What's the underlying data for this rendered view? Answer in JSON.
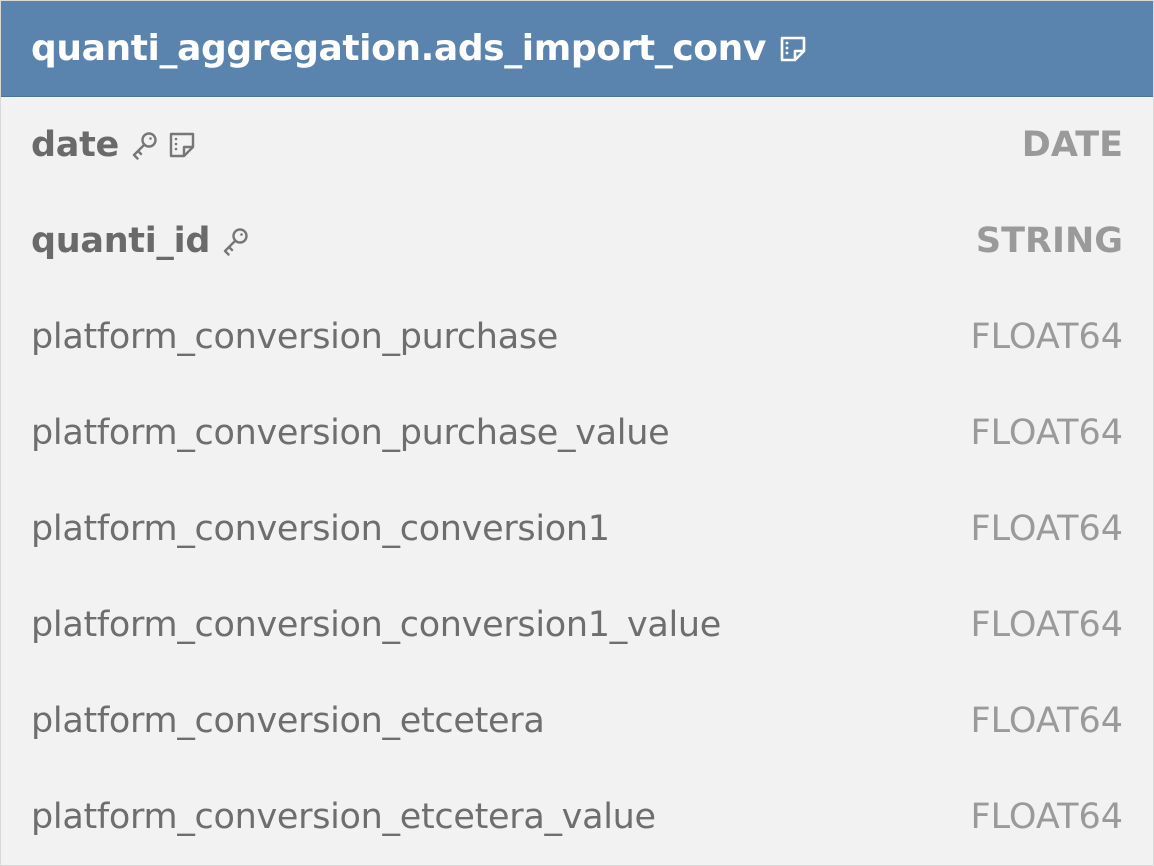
{
  "table": {
    "name": "quanti_aggregation.ads_import_conv",
    "has_note": true
  },
  "columns": [
    {
      "name": "date",
      "type": "DATE",
      "is_key": true,
      "has_note": true
    },
    {
      "name": "quanti_id",
      "type": "STRING",
      "is_key": true,
      "has_note": false
    },
    {
      "name": "platform_conversion_purchase",
      "type": "FLOAT64",
      "is_key": false,
      "has_note": false
    },
    {
      "name": "platform_conversion_purchase_value",
      "type": "FLOAT64",
      "is_key": false,
      "has_note": false
    },
    {
      "name": "platform_conversion_conversion1",
      "type": "FLOAT64",
      "is_key": false,
      "has_note": false
    },
    {
      "name": "platform_conversion_conversion1_value",
      "type": "FLOAT64",
      "is_key": false,
      "has_note": false
    },
    {
      "name": "platform_conversion_etcetera",
      "type": "FLOAT64",
      "is_key": false,
      "has_note": false
    },
    {
      "name": "platform_conversion_etcetera_value",
      "type": "FLOAT64",
      "is_key": false,
      "has_note": false
    }
  ],
  "icons": {
    "header_note": "note-icon",
    "key": "key-icon",
    "column_note": "note-icon"
  },
  "colors": {
    "header_bg": "#5a84ad",
    "header_text": "#ffffff",
    "body_bg": "#f2f2f2",
    "name_text": "#6e6e6e",
    "type_text": "#9a9a9a"
  }
}
